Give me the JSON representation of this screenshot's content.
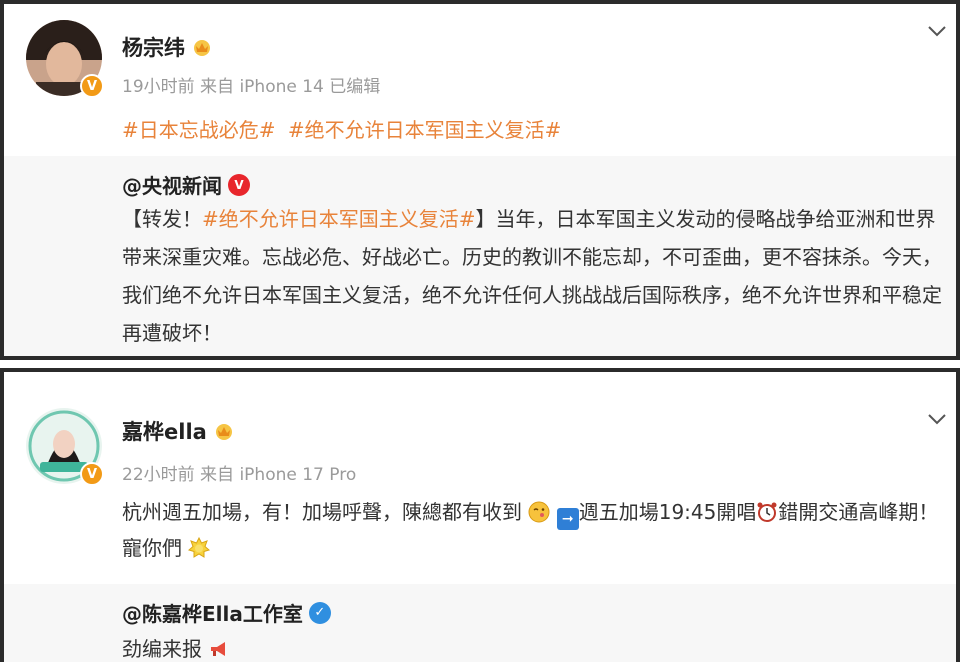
{
  "post1": {
    "username": "杨宗纬",
    "meta": "19小时前 来自 iPhone 14 已编辑",
    "tags": [
      "#日本忘战必危#",
      "#绝不允许日本军国主义复活#"
    ],
    "repost": {
      "author": "@央视新闻",
      "prefix": "【转发！",
      "tag": "#绝不允许日本军国主义复活#",
      "text": "】当年，日本军国主义发动的侵略战争给亚洲和世界带来深重灾难。忘战必危、好战必亡。历史的教训不能忘却，不可歪曲，更不容抹杀。今天，我们绝不允许日本军国主义复活，绝不允许任何人挑战战后国际秩序，绝不允许世界和平稳定再遭破坏！"
    }
  },
  "post2": {
    "username": "嘉桦ella",
    "meta": "22小时前 来自 iPhone 17 Pro",
    "text_part1": "杭州週五加場，有！加場呼聲，陳總都有收到",
    "text_part2": "週五加場19:45開唱",
    "text_part3": "錯開交通高峰期！ 寵你們",
    "repost": {
      "author": "@陈嘉桦Ella工作室",
      "text": "劲编来报"
    }
  },
  "colors": {
    "tag_orange": "#e8833a",
    "vip_gold": "#f29a16",
    "verify_red": "#e8262c",
    "verify_blue": "#2f8fe0"
  }
}
